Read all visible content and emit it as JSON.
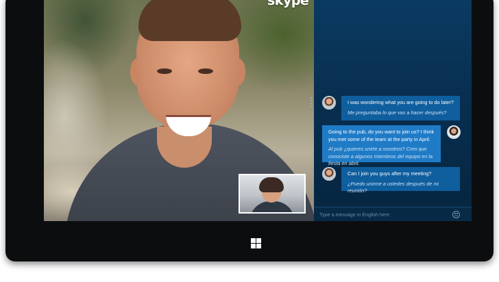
{
  "app": {
    "logo_text": "skype"
  },
  "messages": [
    {
      "direction": "incoming",
      "text": "I was wondering what you are going to do later?",
      "translation": "Me preguntaba lo que vas a hacer después?"
    },
    {
      "direction": "outgoing",
      "text": "Going to the pub, do you want to join us? I think you met some of the team at the party in April.",
      "translation": "Al pub ¿quieres unirte a nosotros? Creo que conociste a algunos miembros del equipo en la fiesta en abril."
    },
    {
      "direction": "incoming",
      "text": "Can I join you guys after my meeting?",
      "translation": "¿Puedo unirme a ustedes después de mi reunión?"
    }
  ],
  "composer": {
    "placeholder": "Type a message in English here",
    "value": ""
  },
  "colors": {
    "chat_bg": "#0b3b63",
    "bubble_incoming": "#0f5e9e",
    "bubble_outgoing": "#1f7bc6",
    "device": "#0c0d0f"
  },
  "icons": [
    "skype-logo",
    "pane-handle-icon",
    "emoji-icon",
    "windows-start-icon",
    "contact-avatar",
    "user-avatar"
  ]
}
